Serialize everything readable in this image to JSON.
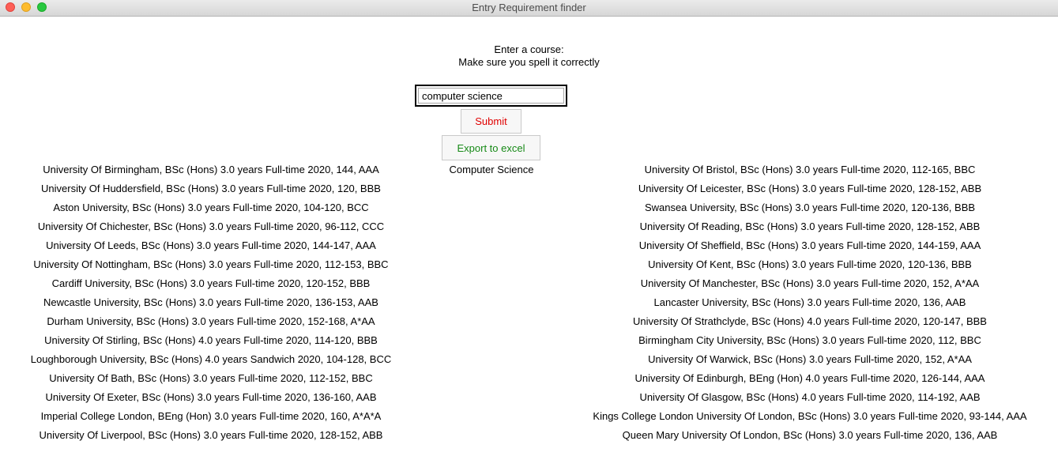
{
  "window": {
    "title": "Entry Requirement finder"
  },
  "prompt": {
    "line1": "Enter a course:",
    "line2": "Make sure you spell it correctly"
  },
  "search": {
    "value": "computer science"
  },
  "buttons": {
    "submit": "Submit",
    "export": "Export to excel"
  },
  "colors": {
    "submit_text": "#e00000",
    "export_text": "#178a17"
  },
  "course_label": "Computer Science",
  "results_left": [
    "University Of Birmingham,  BSc (Hons) 3.0 years Full-time 2020,  144,  AAA",
    "University Of Huddersfield,  BSc (Hons) 3.0 years Full-time 2020,  120,  BBB",
    "Aston University,  BSc (Hons) 3.0 years Full-time 2020,  104-120,  BCC",
    "University Of Chichester,  BSc (Hons) 3.0 years Full-time 2020,  96-112,  CCC",
    "University Of Leeds,  BSc (Hons) 3.0 years Full-time 2020,  144-147,  AAA",
    "University Of Nottingham,  BSc (Hons) 3.0 years Full-time 2020,  112-153,  BBC",
    "Cardiff University,  BSc (Hons) 3.0 years Full-time 2020,  120-152,  BBB",
    "Newcastle University,  BSc (Hons) 3.0 years Full-time 2020,  136-153,  AAB",
    "Durham University,  BSc (Hons) 3.0 years Full-time 2020,  152-168,  A*AA",
    "University Of Stirling,  BSc (Hons) 4.0 years Full-time 2020,  114-120,  BBB",
    "Loughborough University,  BSc (Hons) 4.0 years Sandwich 2020,  104-128,  BCC",
    "University Of Bath,  BSc (Hons) 3.0 years Full-time 2020,  112-152,  BBC",
    "University Of Exeter,  BSc (Hons) 3.0 years Full-time 2020,  136-160,  AAB",
    "Imperial College London,  BEng (Hon) 3.0 years Full-time 2020,  160,  A*A*A",
    "University Of Liverpool,  BSc (Hons) 3.0 years Full-time 2020,  128-152,  ABB"
  ],
  "results_right": [
    "University Of Bristol,  BSc (Hons) 3.0 years Full-time 2020,  112-165,  BBC",
    "University Of Leicester,  BSc (Hons) 3.0 years Full-time 2020,  128-152,  ABB",
    "Swansea University,  BSc (Hons) 3.0 years Full-time 2020,  120-136,  BBB",
    "University Of Reading,  BSc (Hons) 3.0 years Full-time 2020,  128-152,  ABB",
    "University Of Sheffield,  BSc (Hons) 3.0 years Full-time 2020,  144-159,  AAA",
    "University Of Kent,  BSc (Hons) 3.0 years Full-time 2020,  120-136,  BBB",
    "University Of Manchester,  BSc (Hons) 3.0 years Full-time 2020,  152,  A*AA",
    "Lancaster University,  BSc (Hons) 3.0 years Full-time 2020,  136,  AAB",
    "University Of Strathclyde,  BSc (Hons) 4.0 years Full-time 2020,  120-147,  BBB",
    "Birmingham City University,  BSc (Hons) 3.0 years Full-time 2020,  112,  BBC",
    "University Of Warwick,  BSc (Hons) 3.0 years Full-time 2020,  152,  A*AA",
    "University Of Edinburgh,  BEng (Hon) 4.0 years Full-time 2020,  126-144,  AAA",
    "University Of Glasgow,  BSc (Hons) 4.0 years Full-time 2020,  114-192,  AAB",
    "Kings College London University Of London,  BSc (Hons) 3.0 years Full-time 2020,  93-144,  AAA",
    "Queen Mary University Of London,  BSc (Hons) 3.0 years Full-time 2020,  136,  AAB"
  ]
}
